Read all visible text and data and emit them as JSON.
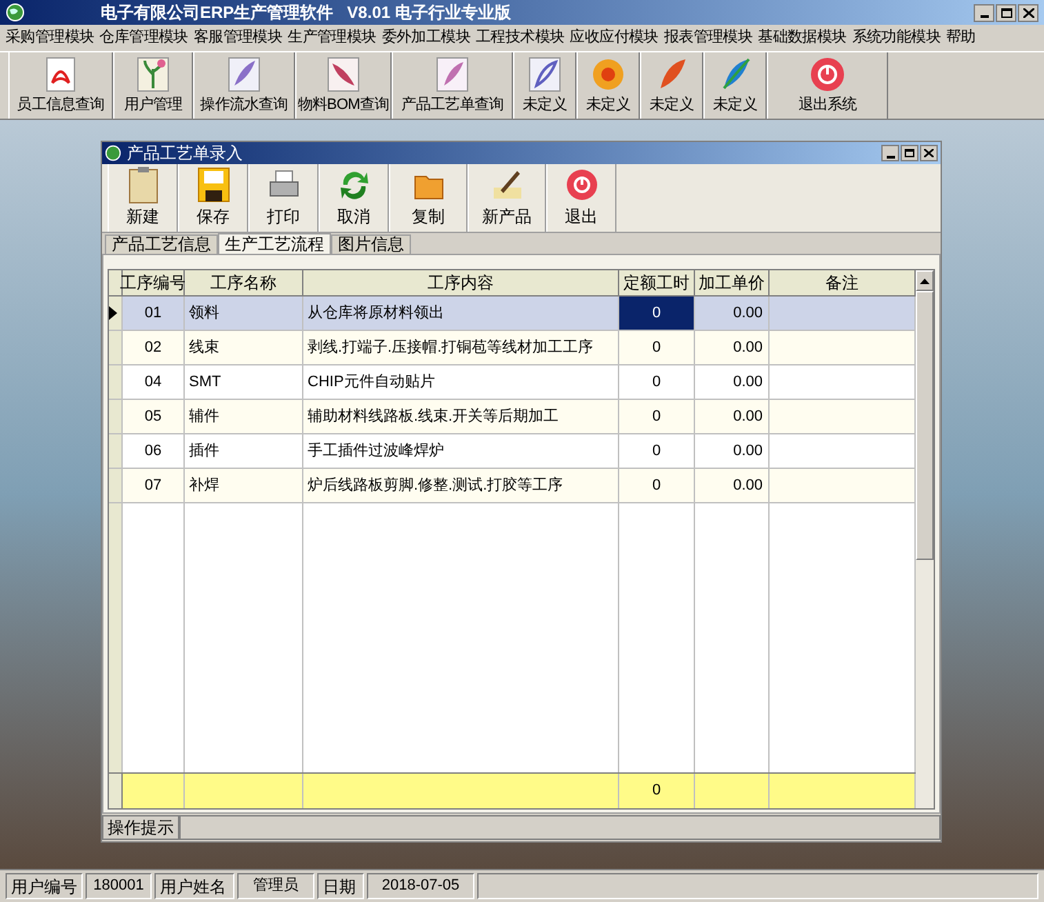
{
  "window": {
    "title": "电子有限公司ERP生产管理软件   V8.01 电子行业专业版"
  },
  "menu": [
    "采购管理模块",
    "仓库管理模块",
    "客服管理模块",
    "生产管理模块",
    "委外加工模块",
    "工程技术模块",
    "应收应付模块",
    "报表管理模块",
    "基础数据模块",
    "系统功能模块",
    "帮助"
  ],
  "toolbar": [
    "员工信息查询",
    "用户管理",
    "操作流水查询",
    "物料BOM查询",
    "产品工艺单查询",
    "未定义",
    "未定义",
    "未定义",
    "未定义",
    "退出系统"
  ],
  "child_window": {
    "title": "产品工艺单录入",
    "toolbar": [
      "新建",
      "保存",
      "打印",
      "取消",
      "复制",
      "新产品",
      "退出"
    ],
    "tabs": [
      {
        "label": "产品工艺信息",
        "selected": false
      },
      {
        "label": "生产工艺流程",
        "selected": true
      },
      {
        "label": "图片信息",
        "selected": false
      }
    ],
    "table": {
      "columns": [
        "工序编号",
        "工序名称",
        "工序内容",
        "定额工时",
        "加工单价",
        "备注"
      ],
      "rows": [
        {
          "selected": true,
          "cells": [
            "01",
            "领料",
            "从仓库将原材料领出",
            "0",
            "0.00"
          ]
        },
        {
          "selected": false,
          "cells": [
            "02",
            "线束",
            "剥线.打端子.压接帽.打铜苞等线材加工工序",
            "0",
            "0.00"
          ]
        },
        {
          "selected": false,
          "cells": [
            "04",
            "SMT",
            "CHIP元件自动贴片",
            "0",
            "0.00"
          ]
        },
        {
          "selected": false,
          "cells": [
            "05",
            "辅件",
            "辅助材料线路板.线束.开关等后期加工",
            "0",
            "0.00"
          ]
        },
        {
          "selected": false,
          "cells": [
            "06",
            "插件",
            "手工插件过波峰焊炉",
            "0",
            "0.00"
          ]
        },
        {
          "selected": false,
          "cells": [
            "07",
            "补焊",
            "炉后线路板剪脚.修整.测试.打胶等工序",
            "0",
            "0.00"
          ]
        }
      ],
      "total": "0"
    },
    "hint": "操作提示"
  },
  "status_bar": [
    {
      "kind": "label",
      "text": "用户编号"
    },
    {
      "kind": "value",
      "text": "180001"
    },
    {
      "kind": "label",
      "text": "用户姓名"
    },
    {
      "kind": "value",
      "text": "管理员"
    },
    {
      "kind": "label",
      "text": "日期"
    },
    {
      "kind": "value",
      "text": "2018-07-05"
    }
  ]
}
